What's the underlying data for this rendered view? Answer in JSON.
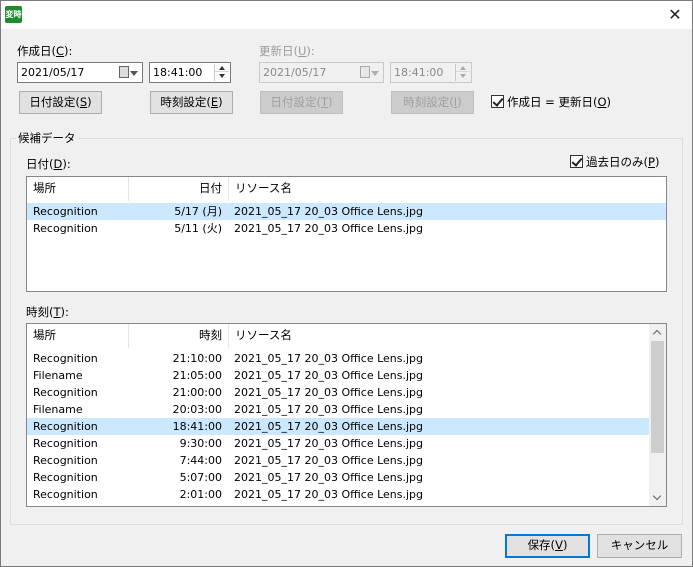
{
  "titlebar": {
    "icon_text": "変時",
    "close_glyph": "✕"
  },
  "created": {
    "label": "作成日(",
    "label_key": "C",
    "label_end": "):",
    "date": "2021/05/17",
    "time": "18:41:00",
    "date_btn": "日付設定(",
    "date_btn_key": "S",
    "date_btn_end": ")",
    "time_btn": "時刻設定(",
    "time_btn_key": "E",
    "time_btn_end": ")"
  },
  "updated": {
    "label": "更新日(",
    "label_key": "U",
    "label_end": "):",
    "date": "2021/05/17",
    "time": "18:41:00",
    "date_btn": "日付設定(",
    "date_btn_key": "T",
    "date_btn_end": ")",
    "time_btn": "時刻設定(",
    "time_btn_key": "I",
    "time_btn_end": ")"
  },
  "sync_checkbox": {
    "label": "作成日 = 更新日(",
    "key": "O",
    "end": ")",
    "checked": true
  },
  "candidates": {
    "title": "候補データ",
    "date_list": {
      "label": "日付(",
      "label_key": "D",
      "label_end": "):",
      "past_only": {
        "label": "過去日のみ(",
        "key": "P",
        "end": ")",
        "checked": true
      },
      "columns": [
        "場所",
        "日付",
        "リソース名"
      ],
      "rows": [
        {
          "place": "Recognition",
          "value": "5/17 (月)",
          "resource": "2021_05_17 20_03 Office Lens.jpg",
          "selected": true
        },
        {
          "place": "Recognition",
          "value": "5/11 (火)",
          "resource": "2021_05_17 20_03 Office Lens.jpg",
          "selected": false
        }
      ]
    },
    "time_list": {
      "label": "時刻(",
      "label_key": "T",
      "label_end": "):",
      "columns": [
        "場所",
        "時刻",
        "リソース名"
      ],
      "rows": [
        {
          "place": "Recognition",
          "value": "21:10:00",
          "resource": "2021_05_17 20_03 Office Lens.jpg",
          "selected": false
        },
        {
          "place": "Filename",
          "value": "21:05:00",
          "resource": "2021_05_17 20_03 Office Lens.jpg",
          "selected": false
        },
        {
          "place": "Recognition",
          "value": "21:00:00",
          "resource": "2021_05_17 20_03 Office Lens.jpg",
          "selected": false
        },
        {
          "place": "Filename",
          "value": "20:03:00",
          "resource": "2021_05_17 20_03 Office Lens.jpg",
          "selected": false
        },
        {
          "place": "Recognition",
          "value": "18:41:00",
          "resource": "2021_05_17 20_03 Office Lens.jpg",
          "selected": true
        },
        {
          "place": "Recognition",
          "value": "9:30:00",
          "resource": "2021_05_17 20_03 Office Lens.jpg",
          "selected": false
        },
        {
          "place": "Recognition",
          "value": "7:44:00",
          "resource": "2021_05_17 20_03 Office Lens.jpg",
          "selected": false
        },
        {
          "place": "Recognition",
          "value": "5:07:00",
          "resource": "2021_05_17 20_03 Office Lens.jpg",
          "selected": false
        },
        {
          "place": "Recognition",
          "value": "2:01:00",
          "resource": "2021_05_17 20_03 Office Lens.jpg",
          "selected": false
        }
      ]
    }
  },
  "footer": {
    "save": "保存(",
    "save_key": "V",
    "save_end": ")",
    "cancel": "キャンセル"
  },
  "colors": {
    "selection": "#cce8ff",
    "default_button_border": "#0078d7"
  }
}
